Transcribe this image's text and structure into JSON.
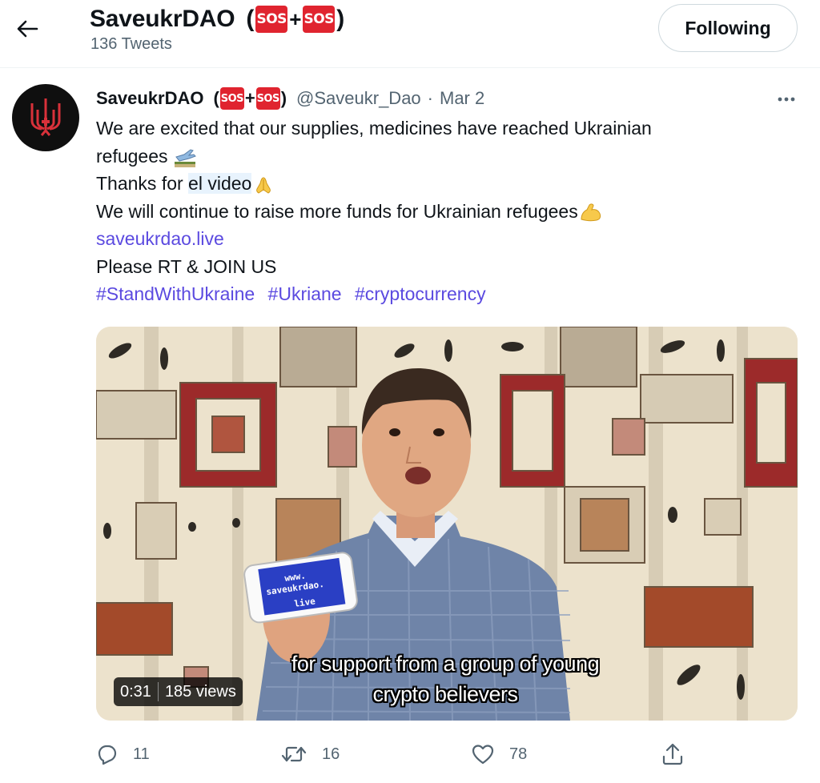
{
  "header": {
    "title": "SaveukrDAO",
    "sos_left": "SOS",
    "sos_plus": "+",
    "sos_right": "SOS",
    "tweet_count": "136 Tweets",
    "follow_label": "Following"
  },
  "tweet": {
    "author_name": "SaveukrDAO",
    "sos_left": "SOS",
    "sos_plus": "+",
    "sos_right": "SOS",
    "handle": "@Saveukr_Dao",
    "separator": "·",
    "date": "Mar 2",
    "lines": {
      "l1": "We are excited that our supplies, medicines have reached Ukrainian",
      "l2": "refugees",
      "l3_prefix": "Thanks for ",
      "l3_link": "el video",
      "l4": "We will continue to raise more funds for Ukrainian refugees",
      "l5_link": "saveukrdao.live",
      "l6": "Please RT & JOIN US"
    },
    "hashtags": [
      "#StandWithUkraine",
      "#Ukriane",
      "#cryptocurrency"
    ],
    "emojis": [
      "airplane-departure-emoji",
      "folded-hands-emoji",
      "flexed-biceps-emoji"
    ]
  },
  "video": {
    "phone_text_1": "www.",
    "phone_text_2": "saveukrdao.",
    "phone_text_3": "live",
    "duration": "0:31",
    "views": "185 views",
    "caption_line1": "for support from a group of young",
    "caption_line2": "crypto believers"
  },
  "actions": {
    "replies": "11",
    "retweets": "16",
    "likes": "78"
  },
  "colors": {
    "link": "#5b4ae0",
    "sos_red": "#e0242f",
    "muted": "#536471",
    "text": "#0f1419"
  }
}
